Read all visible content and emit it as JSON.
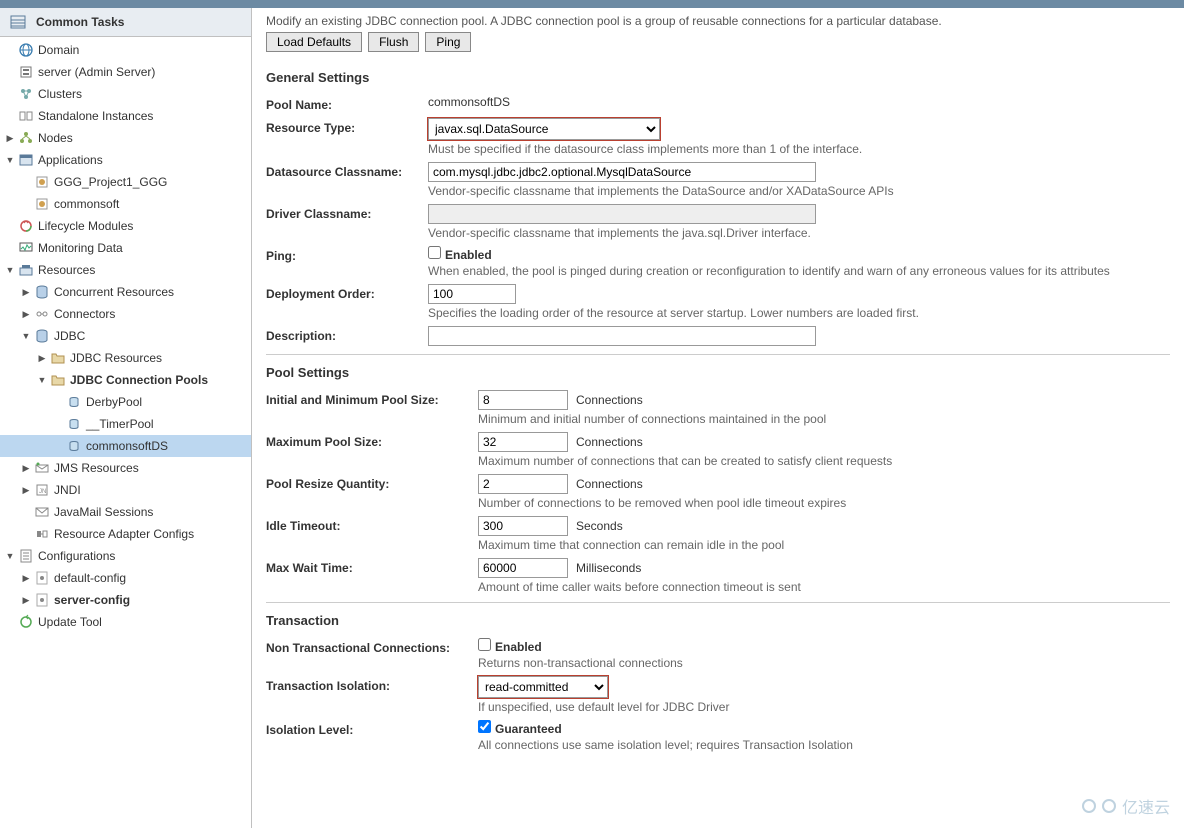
{
  "sidebar": {
    "title": "Common Tasks",
    "nodes": [
      {
        "indent": 0,
        "toggle": "",
        "icon": "globe",
        "label": "Domain",
        "bold": false,
        "sel": false
      },
      {
        "indent": 0,
        "toggle": "",
        "icon": "server",
        "label": "server (Admin Server)",
        "bold": false,
        "sel": false
      },
      {
        "indent": 0,
        "toggle": "",
        "icon": "cluster",
        "label": "Clusters",
        "bold": false,
        "sel": false
      },
      {
        "indent": 0,
        "toggle": "",
        "icon": "instance",
        "label": "Standalone Instances",
        "bold": false,
        "sel": false
      },
      {
        "indent": 0,
        "toggle": "right",
        "icon": "nodes",
        "label": "Nodes",
        "bold": false,
        "sel": false
      },
      {
        "indent": 0,
        "toggle": "down",
        "icon": "apps",
        "label": "Applications",
        "bold": false,
        "sel": false
      },
      {
        "indent": 1,
        "toggle": "",
        "icon": "app",
        "label": "GGG_Project1_GGG",
        "bold": false,
        "sel": false
      },
      {
        "indent": 1,
        "toggle": "",
        "icon": "app",
        "label": "commonsoft",
        "bold": false,
        "sel": false
      },
      {
        "indent": 0,
        "toggle": "",
        "icon": "lifecycle",
        "label": "Lifecycle Modules",
        "bold": false,
        "sel": false
      },
      {
        "indent": 0,
        "toggle": "",
        "icon": "monitor",
        "label": "Monitoring Data",
        "bold": false,
        "sel": false
      },
      {
        "indent": 0,
        "toggle": "down",
        "icon": "resources",
        "label": "Resources",
        "bold": false,
        "sel": false
      },
      {
        "indent": 1,
        "toggle": "right",
        "icon": "db",
        "label": "Concurrent Resources",
        "bold": false,
        "sel": false
      },
      {
        "indent": 1,
        "toggle": "right",
        "icon": "connector",
        "label": "Connectors",
        "bold": false,
        "sel": false
      },
      {
        "indent": 1,
        "toggle": "down",
        "icon": "db",
        "label": "JDBC",
        "bold": false,
        "sel": false
      },
      {
        "indent": 2,
        "toggle": "right",
        "icon": "folder",
        "label": "JDBC Resources",
        "bold": false,
        "sel": false
      },
      {
        "indent": 2,
        "toggle": "down",
        "icon": "folder",
        "label": "JDBC Connection Pools",
        "bold": true,
        "sel": false
      },
      {
        "indent": 3,
        "toggle": "",
        "icon": "pool",
        "label": "DerbyPool",
        "bold": false,
        "sel": false
      },
      {
        "indent": 3,
        "toggle": "",
        "icon": "pool",
        "label": "__TimerPool",
        "bold": false,
        "sel": false
      },
      {
        "indent": 3,
        "toggle": "",
        "icon": "pool",
        "label": "commonsoftDS",
        "bold": false,
        "sel": true
      },
      {
        "indent": 1,
        "toggle": "right",
        "icon": "jms",
        "label": "JMS Resources",
        "bold": false,
        "sel": false
      },
      {
        "indent": 1,
        "toggle": "right",
        "icon": "jndi",
        "label": "JNDI",
        "bold": false,
        "sel": false
      },
      {
        "indent": 1,
        "toggle": "",
        "icon": "mail",
        "label": "JavaMail Sessions",
        "bold": false,
        "sel": false
      },
      {
        "indent": 1,
        "toggle": "",
        "icon": "adapter",
        "label": "Resource Adapter Configs",
        "bold": false,
        "sel": false
      },
      {
        "indent": 0,
        "toggle": "down",
        "icon": "config",
        "label": "Configurations",
        "bold": false,
        "sel": false
      },
      {
        "indent": 1,
        "toggle": "right",
        "icon": "config-item",
        "label": "default-config",
        "bold": false,
        "sel": false
      },
      {
        "indent": 1,
        "toggle": "right",
        "icon": "config-item",
        "label": "server-config",
        "bold": true,
        "sel": false
      },
      {
        "indent": 0,
        "toggle": "",
        "icon": "update",
        "label": "Update Tool",
        "bold": false,
        "sel": false
      }
    ]
  },
  "main": {
    "description": "Modify an existing JDBC connection pool. A JDBC connection pool is a group of reusable connections for a particular database.",
    "buttons": {
      "loadDefaults": "Load Defaults",
      "flush": "Flush",
      "ping": "Ping"
    },
    "sections": {
      "general": {
        "title": "General Settings",
        "poolNameLabel": "Pool Name:",
        "poolName": "commonsoftDS",
        "resourceTypeLabel": "Resource Type:",
        "resourceType": "javax.sql.DataSource",
        "resourceTypeHint": "Must be specified if the datasource class implements more than 1 of the interface.",
        "dsClassLabel": "Datasource Classname:",
        "dsClass": "com.mysql.jdbc.jdbc2.optional.MysqlDataSource",
        "dsClassHint": "Vendor-specific classname that implements the DataSource and/or XADataSource APIs",
        "driverClassLabel": "Driver Classname:",
        "driverClass": "",
        "driverClassHint": "Vendor-specific classname that implements the java.sql.Driver interface.",
        "pingLabel": "Ping:",
        "pingEnabled": "Enabled",
        "pingHint": "When enabled, the pool is pinged during creation or reconfiguration to identify and warn of any erroneous values for its attributes",
        "deployOrderLabel": "Deployment Order:",
        "deployOrder": "100",
        "deployOrderHint": "Specifies the loading order of the resource at server startup. Lower numbers are loaded first.",
        "descriptionLabel": "Description:",
        "descriptionVal": ""
      },
      "pool": {
        "title": "Pool Settings",
        "initLabel": "Initial and Minimum Pool Size:",
        "initVal": "8",
        "initUnit": "Connections",
        "initHint": "Minimum and initial number of connections maintained in the pool",
        "maxLabel": "Maximum Pool Size:",
        "maxVal": "32",
        "maxUnit": "Connections",
        "maxHint": "Maximum number of connections that can be created to satisfy client requests",
        "resizeLabel": "Pool Resize Quantity:",
        "resizeVal": "2",
        "resizeUnit": "Connections",
        "resizeHint": "Number of connections to be removed when pool idle timeout expires",
        "idleLabel": "Idle Timeout:",
        "idleVal": "300",
        "idleUnit": "Seconds",
        "idleHint": "Maximum time that connection can remain idle in the pool",
        "waitLabel": "Max Wait Time:",
        "waitVal": "60000",
        "waitUnit": "Milliseconds",
        "waitHint": "Amount of time caller waits before connection timeout is sent"
      },
      "txn": {
        "title": "Transaction",
        "nonTxnLabel": "Non Transactional Connections:",
        "nonTxnEnabled": "Enabled",
        "nonTxnHint": "Returns non-transactional connections",
        "isoLabel": "Transaction Isolation:",
        "isoVal": "read-committed",
        "isoHint": "If unspecified, use default level for JDBC Driver",
        "isoLevelLabel": "Isolation Level:",
        "isoLevelVal": "Guaranteed",
        "isoLevelHint": "All connections use same isolation level; requires Transaction Isolation"
      }
    }
  },
  "watermark": "亿速云"
}
